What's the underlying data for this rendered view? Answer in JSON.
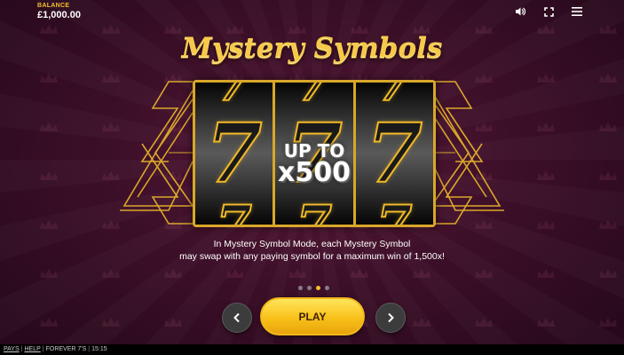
{
  "balance": {
    "label": "BALANCE",
    "value": "£1,000.00"
  },
  "top_icons": [
    "speaker-icon",
    "fullscreen-icon",
    "menu-icon"
  ],
  "title": "Mystery Symbols",
  "reel_symbol": "7",
  "multiplier": {
    "line1": "UP TO",
    "line2": "x500"
  },
  "description": {
    "line1": "In Mystery Symbol Mode, each Mystery Symbol",
    "line2": "may swap with any paying symbol for a maximum win of 1,500x!"
  },
  "pagination": {
    "total": 4,
    "active": 3
  },
  "buttons": {
    "play": "PLAY"
  },
  "footer": {
    "pays": "PAYS",
    "help": "HELP",
    "game": "FOREVER 7'S",
    "time": "15:15"
  },
  "colors": {
    "gold": "#f0c02a",
    "background": "#3d0f28",
    "play_button": "#f9c11a"
  }
}
